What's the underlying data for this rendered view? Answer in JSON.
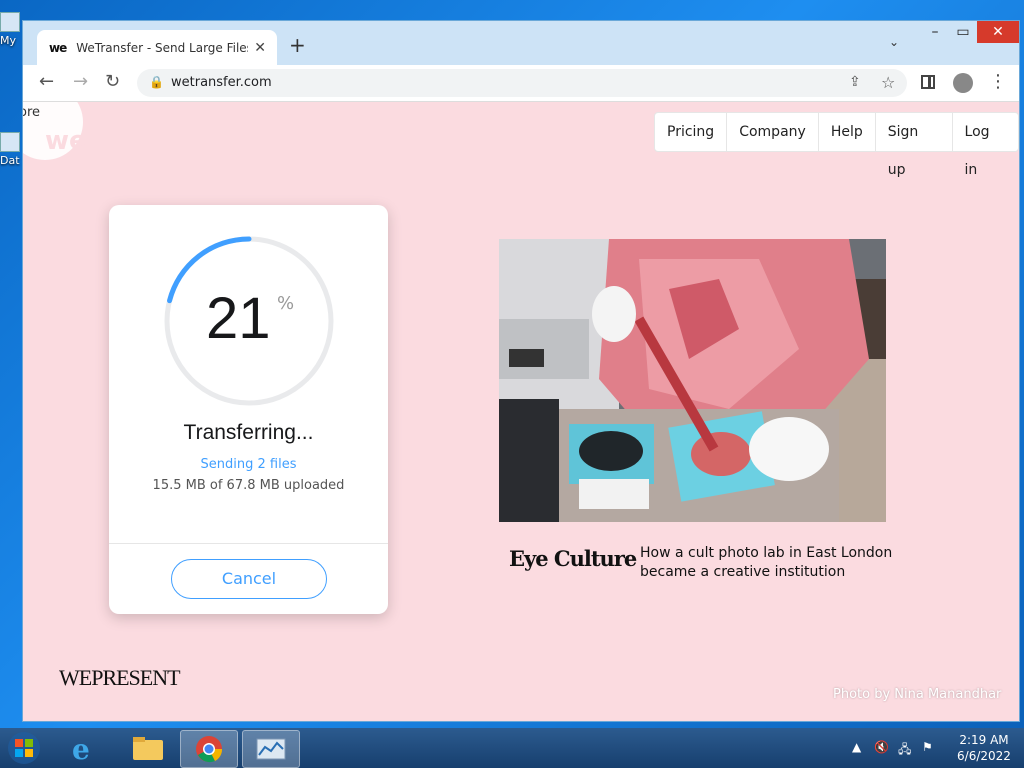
{
  "browser": {
    "tab_title": "WeTransfer - Send Large Files &",
    "tab_favicon": "we",
    "url": "wetransfer.com"
  },
  "desktop": {
    "icon1_label": "My",
    "icon2_label": "Dat"
  },
  "page": {
    "more_text": "ore",
    "nav": [
      "Pricing",
      "Company",
      "Help",
      "Sign up",
      "Log in"
    ],
    "transfer": {
      "percent": "21",
      "percent_sign": "%",
      "progress_fraction": 0.21,
      "status": "Transferring...",
      "sending": "Sending 2 files",
      "uploaded": "15.5 MB of 67.8 MB uploaded",
      "cancel_label": "Cancel"
    },
    "story": {
      "title": "Eye Culture",
      "description": "How a cult photo lab in East London became a creative institution"
    },
    "wepresent": "WEPRESENT",
    "photo_credit": "Photo by Nina Manandhar"
  },
  "taskbar": {
    "time": "2:19 AM",
    "date": "6/6/2022"
  },
  "colors": {
    "page_bg": "#fbdbe0",
    "accent": "#409fff",
    "ring_track": "#e9eaec"
  }
}
